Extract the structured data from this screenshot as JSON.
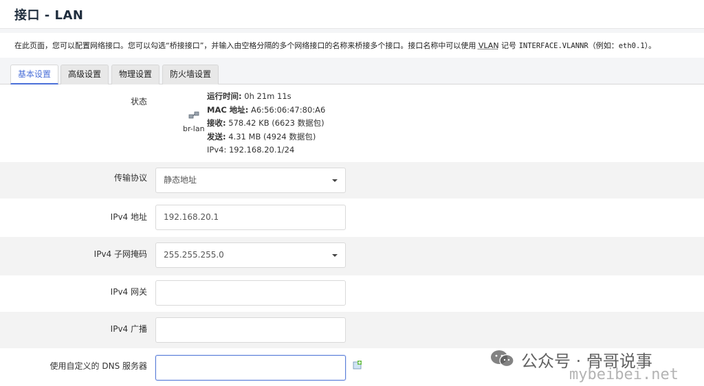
{
  "page": {
    "title": "接口 - LAN",
    "description_pre": "在此页面，您可以配置网络接口。您可以勾选“桥接接口”，并输入由空格分隔的多个网络接口的名称来桥接多个接口。接口名称中可以使用 ",
    "description_vlan": "VLAN",
    "description_mid": " 记号 ",
    "description_code": "INTERFACE.VLANNR",
    "description_post": "（例如：",
    "description_example": "eth0.1",
    "description_end": "）。"
  },
  "tabs": [
    {
      "label": "基本设置",
      "active": true
    },
    {
      "label": "高级设置",
      "active": false
    },
    {
      "label": "物理设置",
      "active": false
    },
    {
      "label": "防火墙设置",
      "active": false
    }
  ],
  "status": {
    "label": "状态",
    "device": "br-lan",
    "uptime_label": "运行时间:",
    "uptime_value": " 0h 21m 11s",
    "mac_label": "MAC 地址:",
    "mac_value": " A6:56:06:47:80:A6",
    "rx_label": "接收:",
    "rx_value": " 578.42 KB (6623 数据包)",
    "tx_label": "发送:",
    "tx_value": " 4.31 MB (4924 数据包)",
    "ipv4_label": "IPv4:",
    "ipv4_value": " 192.168.20.1/24"
  },
  "form": {
    "protocol": {
      "label": "传输协议",
      "value": "静态地址"
    },
    "ipv4_address": {
      "label": "IPv4 地址",
      "value": "192.168.20.1"
    },
    "ipv4_netmask": {
      "label": "IPv4 子网掩码",
      "value": "255.255.255.0"
    },
    "ipv4_gateway": {
      "label": "IPv4 网关",
      "value": ""
    },
    "ipv4_broadcast": {
      "label": "IPv4 广播",
      "value": ""
    },
    "custom_dns": {
      "label": "使用自定义的 DNS 服务器",
      "value": ""
    }
  },
  "watermark": {
    "line1": "公众号 · 骨哥说事",
    "line2": "mybeibei.net"
  },
  "icons": {
    "network": "network-bridge-icon",
    "add": "add-entry-icon",
    "wechat": "wechat-icon"
  }
}
